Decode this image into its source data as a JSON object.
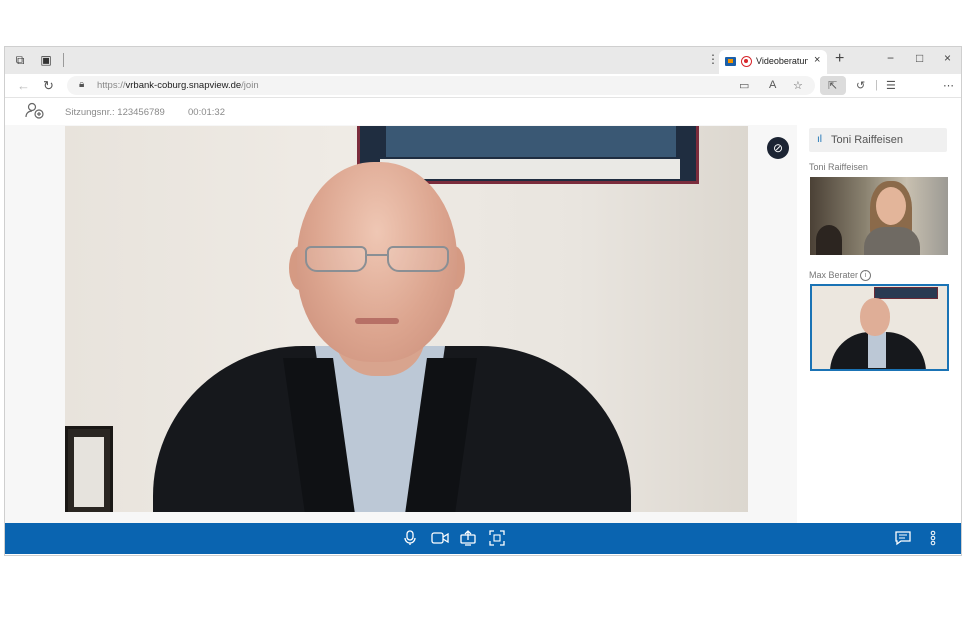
{
  "browser": {
    "tab": {
      "title": "Videoberatung",
      "close": "×"
    },
    "new_tab": "+",
    "window": {
      "minimize": "−",
      "maximize": "□",
      "close": "×"
    },
    "url": {
      "scheme": "https://",
      "host": "vrbank-coburg.snapview.de",
      "path": "/join"
    }
  },
  "session": {
    "label": "Sitzungsnr.:",
    "number": "123456789",
    "timer": "00:01:32"
  },
  "panel": {
    "active_speaker": "Toni Raiffeisen",
    "participants": [
      {
        "name": "Toni Raiffeisen"
      },
      {
        "name": "Max Berater"
      }
    ]
  },
  "colors": {
    "accent": "#0a64b0",
    "selected_border": "#1a73b5",
    "recording": "#d7262b"
  }
}
